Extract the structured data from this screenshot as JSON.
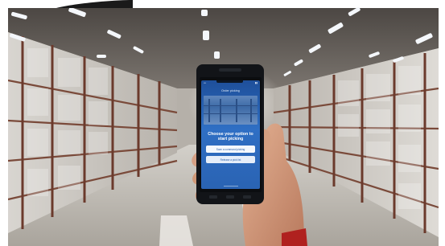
{
  "phone_screen": {
    "brand": "Zebra",
    "title": "Order picking",
    "heading": "Choose your option to start picking",
    "buttons": [
      {
        "label": "Scan a command picking"
      },
      {
        "label": "Release a pick list"
      }
    ]
  },
  "colors": {
    "screen_blue": "#2f6fc4",
    "warehouse_floor": "#c9c6bf",
    "ceiling_light": "#f4f7fb",
    "rack_post": "#6b3a2c"
  },
  "icons": [
    "phone-device",
    "hand"
  ]
}
